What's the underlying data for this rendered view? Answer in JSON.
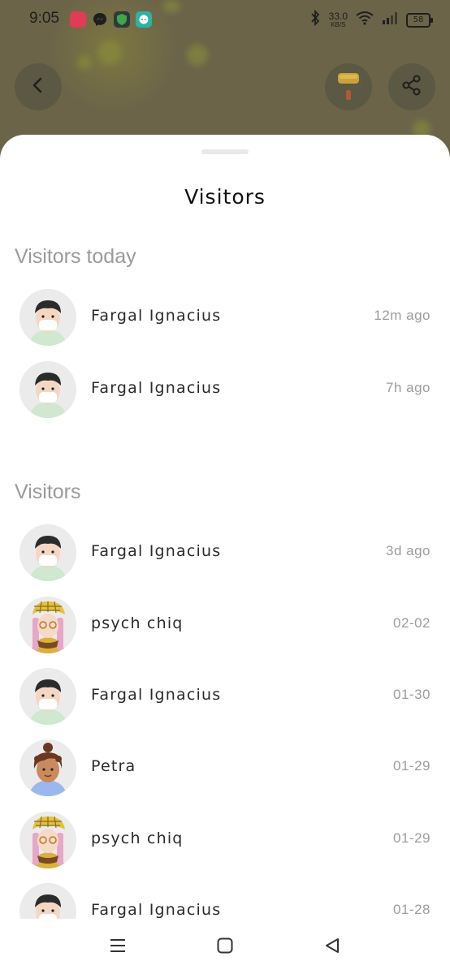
{
  "status_bar": {
    "time": "9:05",
    "net_speed_value": "33.0",
    "net_speed_unit": "KB/S",
    "battery": "58"
  },
  "colors": {
    "overlay": "#6b6449",
    "sheet": "#ffffff",
    "section_title": "#9a9a9a",
    "name": "#2b2b2b",
    "time_ago": "#9d9d9d"
  },
  "sheet": {
    "title": "Visitors"
  },
  "sections": [
    {
      "title": "Visitors today",
      "items": [
        {
          "name": "Fargal Ignacius",
          "time": "12m ago",
          "avatar": "boy-mask-avatar"
        },
        {
          "name": "Fargal Ignacius",
          "time": "7h ago",
          "avatar": "boy-mask-avatar"
        }
      ]
    },
    {
      "title": "Visitors",
      "items": [
        {
          "name": "Fargal Ignacius",
          "time": "3d ago",
          "avatar": "boy-mask-avatar"
        },
        {
          "name": "psych chiq",
          "time": "02-02",
          "avatar": "girl-plaid-hat-avatar"
        },
        {
          "name": "Fargal Ignacius",
          "time": "01-30",
          "avatar": "boy-mask-avatar"
        },
        {
          "name": "Petra",
          "time": "01-29",
          "avatar": "curly-hair-avatar"
        },
        {
          "name": "psych chiq",
          "time": "01-29",
          "avatar": "girl-plaid-hat-avatar"
        },
        {
          "name": "Fargal Ignacius",
          "time": "01-28",
          "avatar": "boy-mask-avatar"
        }
      ]
    }
  ]
}
